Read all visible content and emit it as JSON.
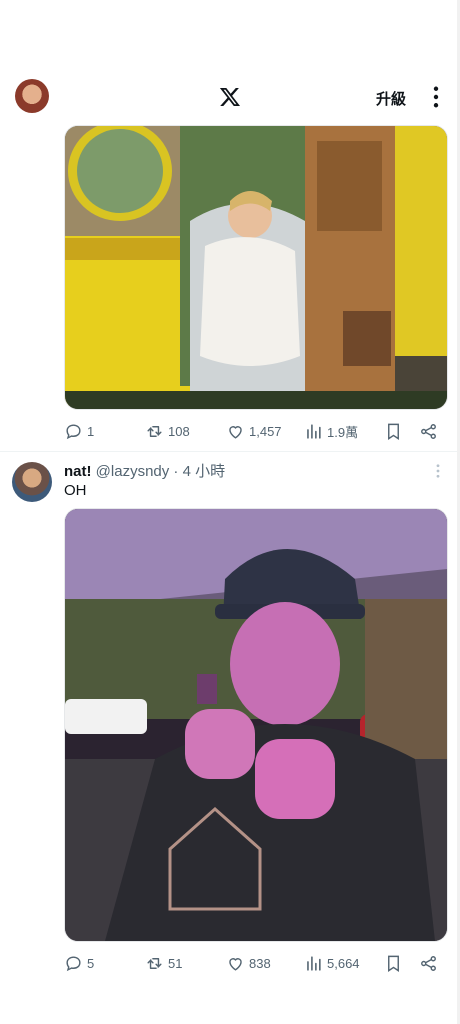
{
  "header": {
    "upgrade_label": "升級",
    "logo_icon": "x-logo-icon",
    "menu_icon": "more-vertical-icon"
  },
  "tweet1": {
    "stats": {
      "replies": "1",
      "reposts": "108",
      "likes": "1,457",
      "views": "1.9萬"
    }
  },
  "tweet2": {
    "display_name": "nat!",
    "meta": "@lazysndy · 4 小時",
    "text": "OH",
    "stats": {
      "replies": "5",
      "reposts": "51",
      "likes": "838",
      "views": "5,664"
    }
  },
  "colors": {
    "accent": "#1d9bf0",
    "muted_text": "#536471",
    "carriage_yellow": "#e9d21c",
    "purple_light": "#b44bd8"
  }
}
